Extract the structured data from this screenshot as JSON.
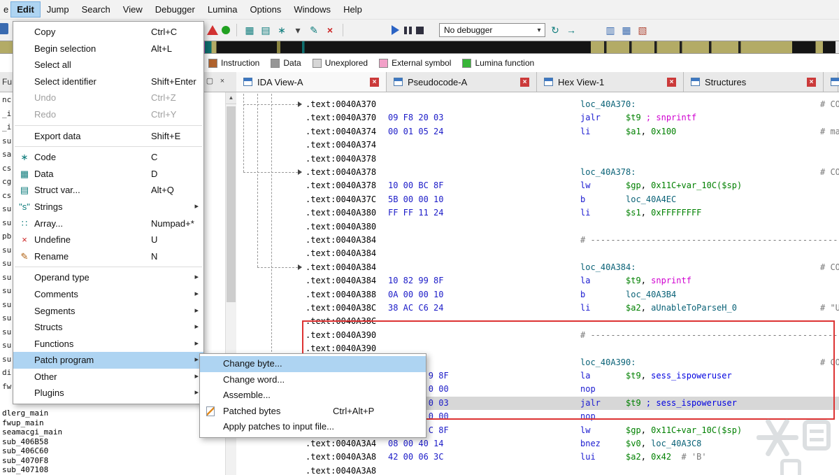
{
  "colors": {
    "green": "#008000",
    "magenta": "#d000d0",
    "dummy": "#0a6277",
    "namec": "#0000e0",
    "mnem": "#1a1ad0",
    "bytes": "#1c1cc8",
    "comment": "#7a7a7a",
    "select": "#aed4f2",
    "redbox": "#dd3333"
  },
  "menubar": {
    "items": [
      {
        "label": "e",
        "partial": true
      },
      {
        "label": "Edit",
        "active": true
      },
      {
        "label": "Jump"
      },
      {
        "label": "Search"
      },
      {
        "label": "View"
      },
      {
        "label": "Debugger"
      },
      {
        "label": "Lumina"
      },
      {
        "label": "Options"
      },
      {
        "label": "Windows"
      },
      {
        "label": "Help"
      }
    ]
  },
  "toolbar": {
    "combo_label": "No debugger",
    "items": [
      {
        "t": "warn",
        "n": "warning-icon"
      },
      {
        "t": "dot",
        "n": "run-indicator-icon"
      },
      {
        "t": "sep"
      },
      {
        "t": "g",
        "g": "▦",
        "c": "#0e7c7c",
        "n": "make-code-icon"
      },
      {
        "t": "g",
        "g": "▤",
        "c": "#0e7c7c",
        "n": "make-data-icon"
      },
      {
        "t": "g",
        "g": "∗",
        "c": "#0e7c7c",
        "n": "make-struct-icon"
      },
      {
        "t": "g",
        "g": "▾",
        "c": "#444444",
        "n": "dropdown-arrow-icon"
      },
      {
        "t": "g",
        "g": "✎",
        "c": "#0e7c7c",
        "n": "edit-icon"
      },
      {
        "t": "g",
        "g": "×",
        "c": "#cc2222",
        "n": "undefine-icon",
        "b": 1
      },
      {
        "t": "sep"
      },
      {
        "t": "gap",
        "w": 55
      },
      {
        "t": "play",
        "n": "start-process-icon"
      },
      {
        "t": "pause",
        "n": "pause-process-icon"
      },
      {
        "t": "stop",
        "n": "stop-process-icon"
      },
      {
        "t": "gap",
        "w": 12
      },
      {
        "t": "combo",
        "n": "debugger-combo"
      },
      {
        "t": "g",
        "g": "↻",
        "c": "#0e7c7c",
        "n": "refresh-icon"
      },
      {
        "t": "g",
        "g": "→",
        "c": "#0e7c7c",
        "n": "step-icon"
      },
      {
        "t": "gap",
        "w": 28
      },
      {
        "t": "g",
        "g": "▥",
        "c": "#3a6bb0",
        "n": "table-icon"
      },
      {
        "t": "g",
        "g": "▦",
        "c": "#3a6bb0",
        "n": "columns-icon"
      },
      {
        "t": "g",
        "g": "▧",
        "c": "#b04a3a",
        "n": "layout-icon"
      }
    ]
  },
  "legend": {
    "items": [
      {
        "label": "Instruction",
        "color": "#b0622d"
      },
      {
        "label": "Data",
        "color": "#969696"
      },
      {
        "label": "Unexplored",
        "color": "#d6d6d6"
      },
      {
        "label": "External symbol",
        "color": "#f2a0c8"
      },
      {
        "label": "Lumina function",
        "color": "#37b537"
      }
    ]
  },
  "tabs": [
    {
      "label": "IDA View-A"
    },
    {
      "label": "Pseudocode-A"
    },
    {
      "label": "Hex View-1"
    },
    {
      "label": "Structures"
    },
    {
      "label": "",
      "partial": true
    }
  ],
  "functions_window": {
    "title_fragment": "Fu",
    "fragments": [
      "nc",
      "_i",
      "_i",
      "su",
      "sa",
      "cs",
      "cg",
      "cs",
      "su",
      "su",
      "pb",
      "su",
      "su",
      "su",
      "su",
      "su",
      "su",
      "su",
      "su",
      "su",
      "di",
      "fw"
    ],
    "names": [
      "dlerg_main",
      "fwup_main",
      "seamacgi_main",
      "sub_406B58",
      "sub_406C60",
      "sub_4070F8",
      "sub_407108"
    ]
  },
  "icon_map": {
    "code": {
      "g": "∗",
      "c": "#0e7c7c"
    },
    "data": {
      "g": "▦",
      "c": "#0e7c7c"
    },
    "structvar": {
      "g": "▤",
      "c": "#0e7c7c"
    },
    "strings": {
      "g": "\"s\"",
      "c": "#0e7c7c"
    },
    "array": {
      "g": "∷",
      "c": "#0e7c7c"
    },
    "undefine": {
      "g": "×",
      "c": "#cc2222"
    },
    "rename": {
      "g": "✎",
      "c": "#b06010"
    },
    "patched": {
      "page": true
    }
  },
  "edit_menu": {
    "items": [
      {
        "label": "Copy",
        "shortcut": "Ctrl+C"
      },
      {
        "label": "Begin selection",
        "shortcut": "Alt+L"
      },
      {
        "label": "Select all"
      },
      {
        "label": "Select identifier",
        "shortcut": "Shift+Enter"
      },
      {
        "label": "Undo",
        "shortcut": "Ctrl+Z",
        "disabled": true
      },
      {
        "label": "Redo",
        "shortcut": "Ctrl+Y",
        "disabled": true,
        "sep_after": true
      },
      {
        "label": "Export data",
        "shortcut": "Shift+E",
        "sep_after": true
      },
      {
        "label": "Code",
        "shortcut": "C",
        "icon": "code"
      },
      {
        "label": "Data",
        "shortcut": "D",
        "icon": "data"
      },
      {
        "label": "Struct var...",
        "shortcut": "Alt+Q",
        "icon": "structvar"
      },
      {
        "label": "Strings",
        "submenu": true,
        "icon": "strings"
      },
      {
        "label": "Array...",
        "shortcut": "Numpad+*",
        "icon": "array"
      },
      {
        "label": "Undefine",
        "shortcut": "U",
        "icon": "undefine"
      },
      {
        "label": "Rename",
        "shortcut": "N",
        "icon": "rename",
        "sep_after": true
      },
      {
        "label": "Operand type",
        "submenu": true
      },
      {
        "label": "Comments",
        "submenu": true
      },
      {
        "label": "Segments",
        "submenu": true
      },
      {
        "label": "Structs",
        "submenu": true
      },
      {
        "label": "Functions",
        "submenu": true
      },
      {
        "label": "Patch program",
        "submenu": true,
        "highlighted": true
      },
      {
        "label": "Other",
        "submenu": true
      },
      {
        "label": "Plugins",
        "submenu": true
      }
    ]
  },
  "patch_submenu": {
    "items": [
      {
        "label": "Change byte...",
        "highlighted": true
      },
      {
        "label": "Change word..."
      },
      {
        "label": "Assemble..."
      },
      {
        "label": "Patched bytes",
        "shortcut": "Ctrl+Alt+P",
        "icon": "patched"
      },
      {
        "label": "Apply patches to input file..."
      }
    ]
  },
  "listing": {
    "sep_text": "# ---------------------------------------------------------------------------",
    "rows": [
      {
        "a": ".text:0040A370",
        "k": "label",
        "l": "loc_40A370:",
        "c": "# CO"
      },
      {
        "a": ".text:0040A370",
        "b": "09 F8 20 03",
        "k": "i",
        "m": "jalr",
        "o": [
          [
            "$t9",
            "g"
          ],
          [
            " ",
            "p"
          ],
          [
            "; snprintf",
            "m"
          ]
        ]
      },
      {
        "a": ".text:0040A374",
        "b": "00 01 05 24",
        "k": "i",
        "m": "li",
        "o": [
          [
            "$a1",
            "g"
          ],
          [
            ", ",
            "p"
          ],
          [
            "0x100",
            "g"
          ]
        ],
        "c": "# ma"
      },
      {
        "a": ".text:0040A374",
        "k": "blank"
      },
      {
        "a": ".text:0040A378",
        "k": "blank"
      },
      {
        "a": ".text:0040A378",
        "k": "label",
        "l": "loc_40A378:",
        "c": "# CO"
      },
      {
        "a": ".text:0040A378",
        "b": "10 00 BC 8F",
        "k": "i",
        "m": "lw",
        "o": [
          [
            "$gp",
            "g"
          ],
          [
            ", ",
            "p"
          ],
          [
            "0x11C+var_10C($sp)",
            "g"
          ]
        ]
      },
      {
        "a": ".text:0040A37C",
        "b": "5B 00 00 10",
        "k": "i",
        "m": "b",
        "o": [
          [
            "loc_40A4EC",
            "d"
          ]
        ]
      },
      {
        "a": ".text:0040A380",
        "b": "FF FF 11 24",
        "k": "i",
        "m": "li",
        "o": [
          [
            "$s1",
            "g"
          ],
          [
            ", ",
            "p"
          ],
          [
            "0xFFFFFFFF",
            "g"
          ]
        ]
      },
      {
        "a": ".text:0040A380",
        "k": "blank"
      },
      {
        "a": ".text:0040A384",
        "k": "sep"
      },
      {
        "a": ".text:0040A384",
        "k": "blank"
      },
      {
        "a": ".text:0040A384",
        "k": "label",
        "l": "loc_40A384:",
        "c": "# CO"
      },
      {
        "a": ".text:0040A384",
        "b": "10 82 99 8F",
        "k": "i",
        "m": "la",
        "o": [
          [
            "$t9",
            "g"
          ],
          [
            ", ",
            "p"
          ],
          [
            "snprintf",
            "m"
          ]
        ]
      },
      {
        "a": ".text:0040A388",
        "b": "0A 00 00 10",
        "k": "i",
        "m": "b",
        "o": [
          [
            "loc_40A3B4",
            "d"
          ]
        ]
      },
      {
        "a": ".text:0040A38C",
        "b": "38 AC C6 24",
        "k": "i",
        "m": "li",
        "o": [
          [
            "$a2",
            "g"
          ],
          [
            ", ",
            "p"
          ],
          [
            "aUnableToParseH_0",
            "s"
          ]
        ],
        "c": "# \"U"
      },
      {
        "a": ".text:0040A38C",
        "k": "blank"
      },
      {
        "a": ".text:0040A390",
        "k": "sep"
      },
      {
        "a": ".text:0040A390",
        "k": "blank"
      },
      {
        "a": "",
        "k": "label",
        "l": "loc_40A390:",
        "c": "# CO"
      },
      {
        "a": "",
        "b": "        9 8F",
        "k": "i",
        "m": "la",
        "o": [
          [
            "$t9",
            "g"
          ],
          [
            ", ",
            "p"
          ],
          [
            "sess_ispoweruser",
            "n"
          ]
        ]
      },
      {
        "a": "",
        "b": "        0 00",
        "k": "i",
        "m": "nop",
        "o": []
      },
      {
        "a": "",
        "b": "        0 03",
        "k": "i",
        "m": "jalr",
        "o": [
          [
            "$t9",
            "g"
          ],
          [
            " ",
            "p"
          ],
          [
            "; sess_ispoweruser",
            "n"
          ]
        ],
        "hl": true
      },
      {
        "a": "",
        "b": "        0 00",
        "k": "i",
        "m": "nop",
        "o": []
      },
      {
        "a": "",
        "b": "        C 8F",
        "k": "i",
        "m": "lw",
        "o": [
          [
            "$gp",
            "g"
          ],
          [
            ", ",
            "p"
          ],
          [
            "0x11C+var_10C($sp)",
            "g"
          ]
        ]
      },
      {
        "a": ".text:0040A3A4",
        "b": "08 00 40 14",
        "k": "i",
        "m": "bnez",
        "o": [
          [
            "$v0",
            "g"
          ],
          [
            ", ",
            "p"
          ],
          [
            "loc_40A3C8",
            "d"
          ]
        ]
      },
      {
        "a": ".text:0040A3A8",
        "b": "42 00 06 3C",
        "k": "i",
        "m": "lui",
        "o": [
          [
            "$a2",
            "g"
          ],
          [
            ", ",
            "p"
          ],
          [
            "0x42",
            "g"
          ],
          [
            "  # 'B'",
            "c"
          ]
        ]
      },
      {
        "a": ".text:0040A3A8",
        "k": "blank"
      }
    ]
  }
}
